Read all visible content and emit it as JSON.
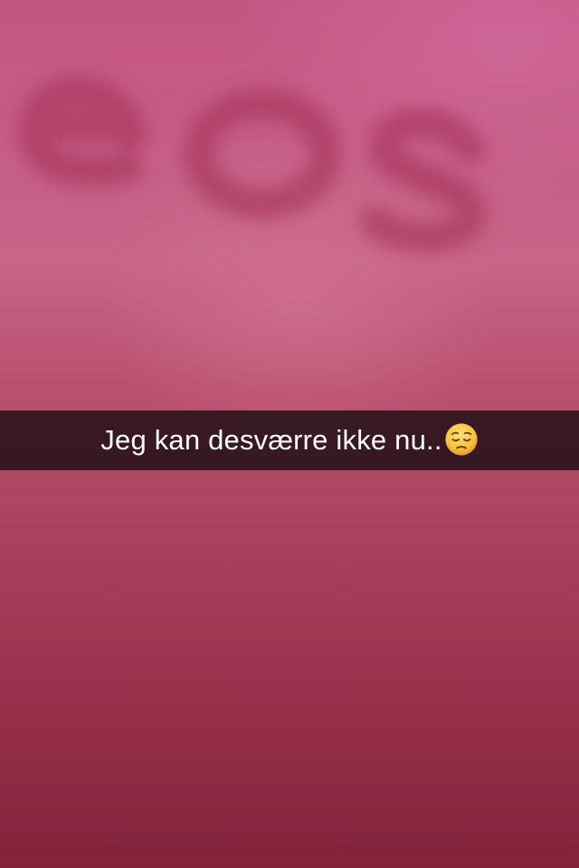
{
  "caption": {
    "text": "Jeg kan desværre ikke nu..",
    "emoji_icon": "pensive-face-icon"
  },
  "colors": {
    "background_top": "#c45682",
    "background_bottom": "#82233a",
    "caption_bar": "#1c0e14",
    "caption_text": "#ffffff",
    "emoji_face": "#f7c23b"
  }
}
